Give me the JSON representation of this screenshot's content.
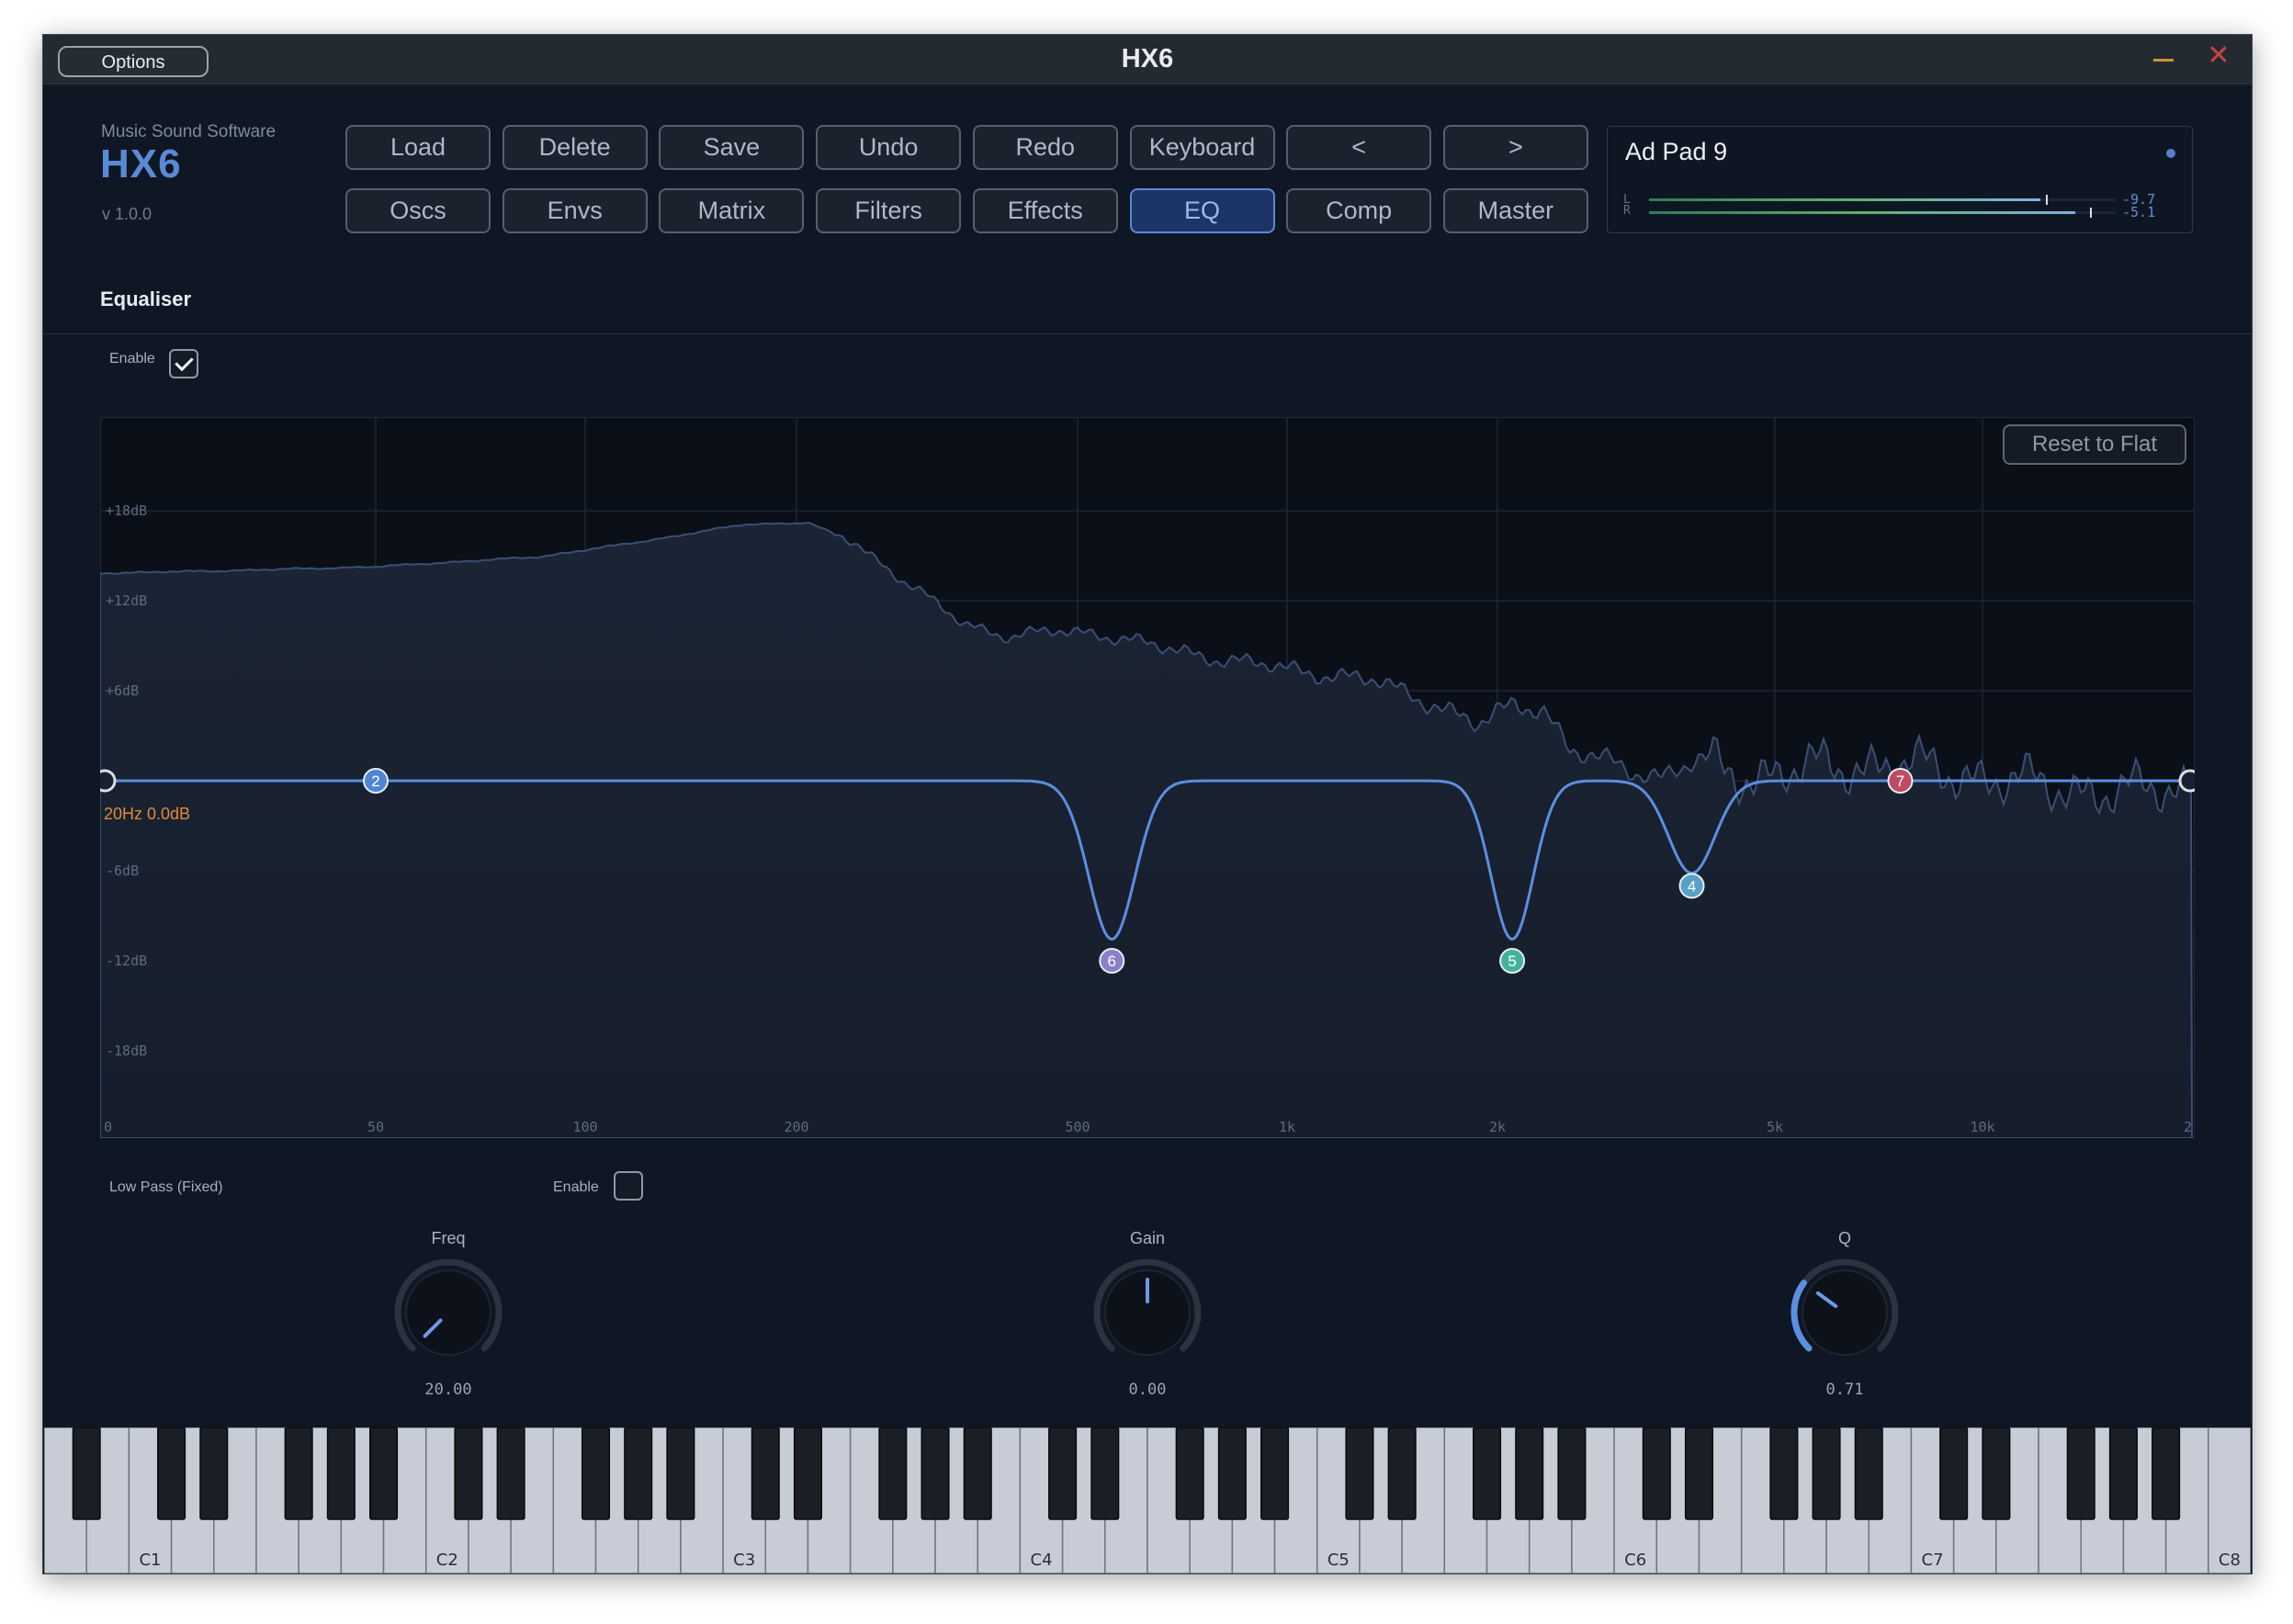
{
  "window": {
    "title": "HX6",
    "options_label": "Options",
    "close_glyph": "✕",
    "accent_color": "#5a8ad6",
    "icons": [
      "minimize-icon",
      "close-icon"
    ]
  },
  "brand": {
    "company": "Music Sound Software",
    "logo_text": "HX6",
    "version": "v 1.0.0"
  },
  "toolbar": {
    "row1": [
      "Load",
      "Delete",
      "Save",
      "Undo",
      "Redo",
      "Keyboard",
      "<",
      ">"
    ],
    "row2": [
      "Oscs",
      "Envs",
      "Matrix",
      "Filters",
      "Effects",
      "EQ",
      "Comp",
      "Master"
    ],
    "active_tab": "EQ"
  },
  "preset": {
    "name": "Ad Pad 9",
    "meter_left_label": "L",
    "meter_right_label": "R",
    "meter_left_value": "-9.7",
    "meter_right_value": "-5.1"
  },
  "equaliser": {
    "title": "Equaliser",
    "enable_label": "Enable",
    "enabled": true,
    "reset_label": "Reset to Flat",
    "cursor_readout": "20Hz  0.0dB",
    "db_labels": [
      "+18dB",
      "+12dB",
      "+6dB",
      "-6dB",
      "-12dB",
      "-18dB"
    ],
    "freq_labels": [
      "0",
      "50",
      "100",
      "200",
      "500",
      "1k",
      "2k",
      "5k",
      "10k",
      "2"
    ],
    "bands": [
      {
        "id": "2",
        "freq": 50,
        "gain": 0,
        "color": "#4f86d4"
      },
      {
        "id": "6",
        "freq": 560,
        "gain": -12,
        "color": "#8a80c8"
      },
      {
        "id": "5",
        "freq": 2100,
        "gain": -12,
        "color": "#43b49a"
      },
      {
        "id": "4",
        "freq": 3800,
        "gain": -7,
        "color": "#5aa0c8"
      },
      {
        "id": "7",
        "freq": 7600,
        "gain": 0,
        "color": "#c04a62"
      }
    ]
  },
  "filter_section": {
    "mode_label": "Low Pass (Fixed)",
    "enable_label": "Enable",
    "enabled": false,
    "knobs": [
      {
        "label": "Freq",
        "value": "20.00",
        "level": 0.0
      },
      {
        "label": "Gain",
        "value": "0.00",
        "level": 0.5
      },
      {
        "label": "Q",
        "value": "0.71",
        "level": 0.3
      }
    ]
  },
  "keyboard": {
    "octave_labels": [
      "C1",
      "C2",
      "C3",
      "C4",
      "C5",
      "C6",
      "C7",
      "C8"
    ]
  }
}
